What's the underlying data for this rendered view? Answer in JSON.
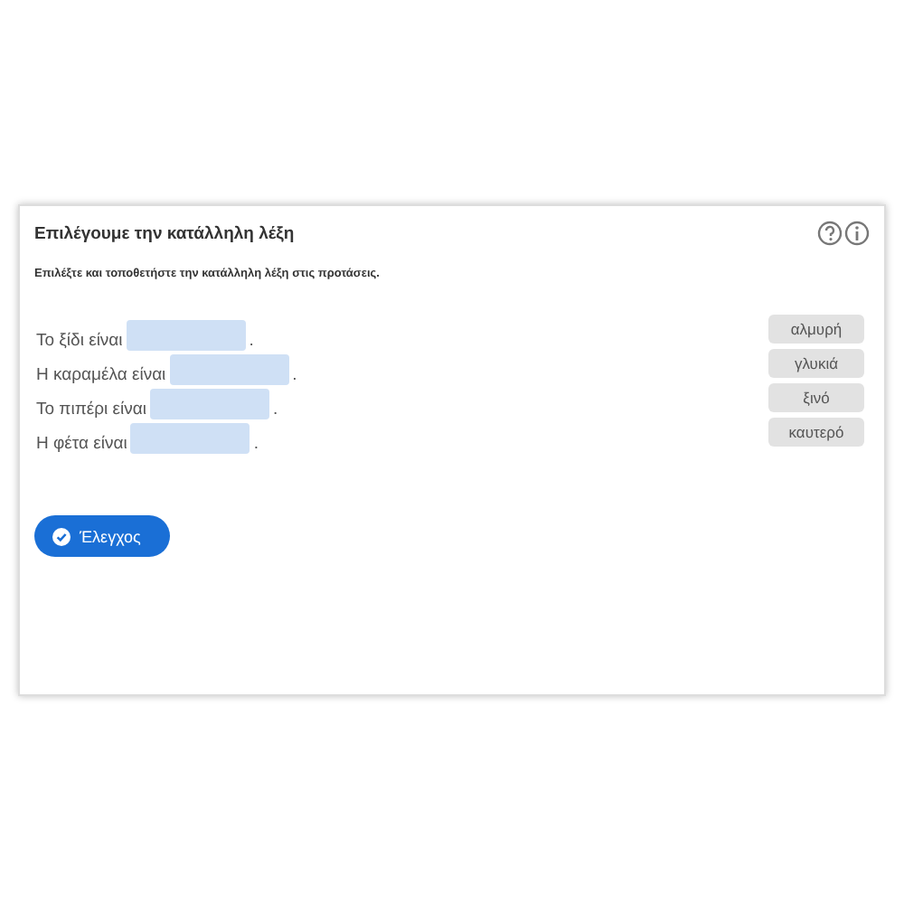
{
  "card": {
    "title": "Επιλέγουμε την κατάλληλη λέξη",
    "instruction": "Επιλέξτε και τοποθετήστε την κατάλληλη λέξη στις προτάσεις.",
    "sentences": [
      {
        "text": "Το ξίδι είναι",
        "end": "."
      },
      {
        "text": "Η καραμέλα είναι",
        "end": "."
      },
      {
        "text": "Το πιπέρι είναι",
        "end": "."
      },
      {
        "text": "Η φέτα είναι",
        "end": "."
      }
    ],
    "words": [
      "αλμυρή",
      "γλυκιά",
      "ξινό",
      "καυτερό"
    ],
    "check_button": "Έλεγχος"
  }
}
